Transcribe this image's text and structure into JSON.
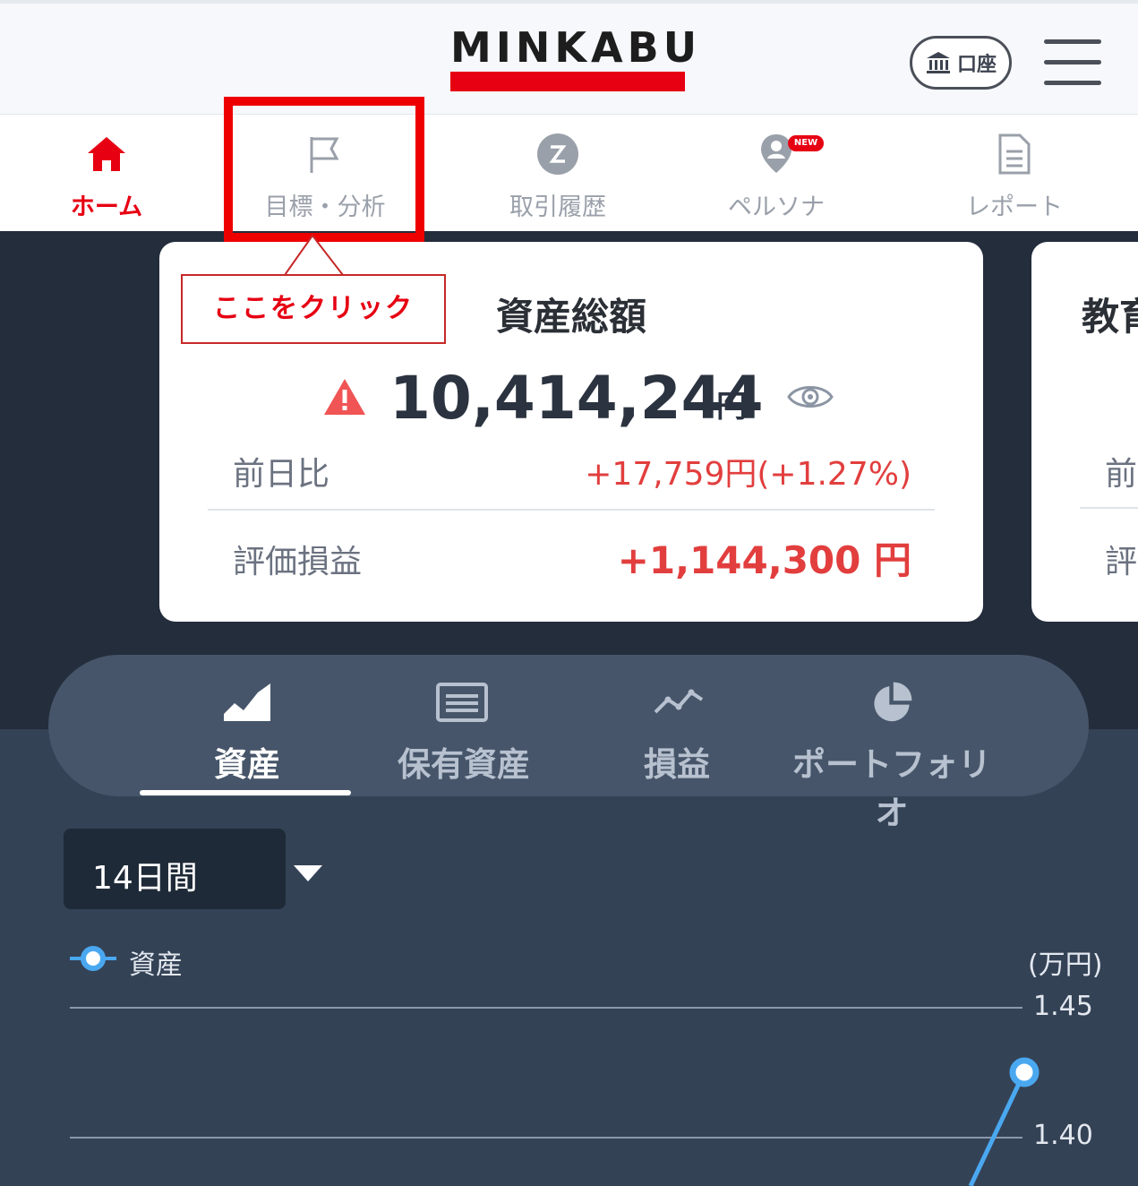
{
  "header": {
    "logo": "MINKABU",
    "account_button": "口座",
    "brand_color": "#e60012"
  },
  "nav": {
    "items": [
      {
        "label": "ホーム",
        "icon": "home-icon",
        "active": true
      },
      {
        "label": "目標・分析",
        "icon": "flag-icon",
        "active": false
      },
      {
        "label": "取引履歴",
        "icon": "history-icon",
        "active": false
      },
      {
        "label": "ペルソナ",
        "icon": "persona-icon",
        "active": false,
        "badge": "NEW"
      },
      {
        "label": "レポート",
        "icon": "report-icon",
        "active": false
      }
    ]
  },
  "callout": {
    "text": "ここをクリック",
    "color": "#e60012"
  },
  "summary_card": {
    "title": "資産総額",
    "total_value": "10,414,244",
    "total_unit": "円",
    "day_change_label": "前日比",
    "day_change_value": "+17,759円(+1.27%)",
    "pl_label": "評価損益",
    "pl_value": "+1,144,300 円"
  },
  "second_card": {
    "title": "教育",
    "row1": "前日比",
    "row2": "評価損益"
  },
  "tabs": [
    {
      "label": "資産",
      "icon": "area-chart-icon",
      "active": true
    },
    {
      "label": "保有資産",
      "icon": "list-icon",
      "active": false
    },
    {
      "label": "損益",
      "icon": "line-chart-icon",
      "active": false
    },
    {
      "label": "ポートフォリオ",
      "icon": "pie-chart-icon",
      "active": false
    }
  ],
  "period_select": "14日間",
  "chart": {
    "legend": "資産",
    "unit": "(万円)",
    "ticks": [
      "1.45",
      "1.40"
    ],
    "series_color": "#4aa8f0"
  }
}
